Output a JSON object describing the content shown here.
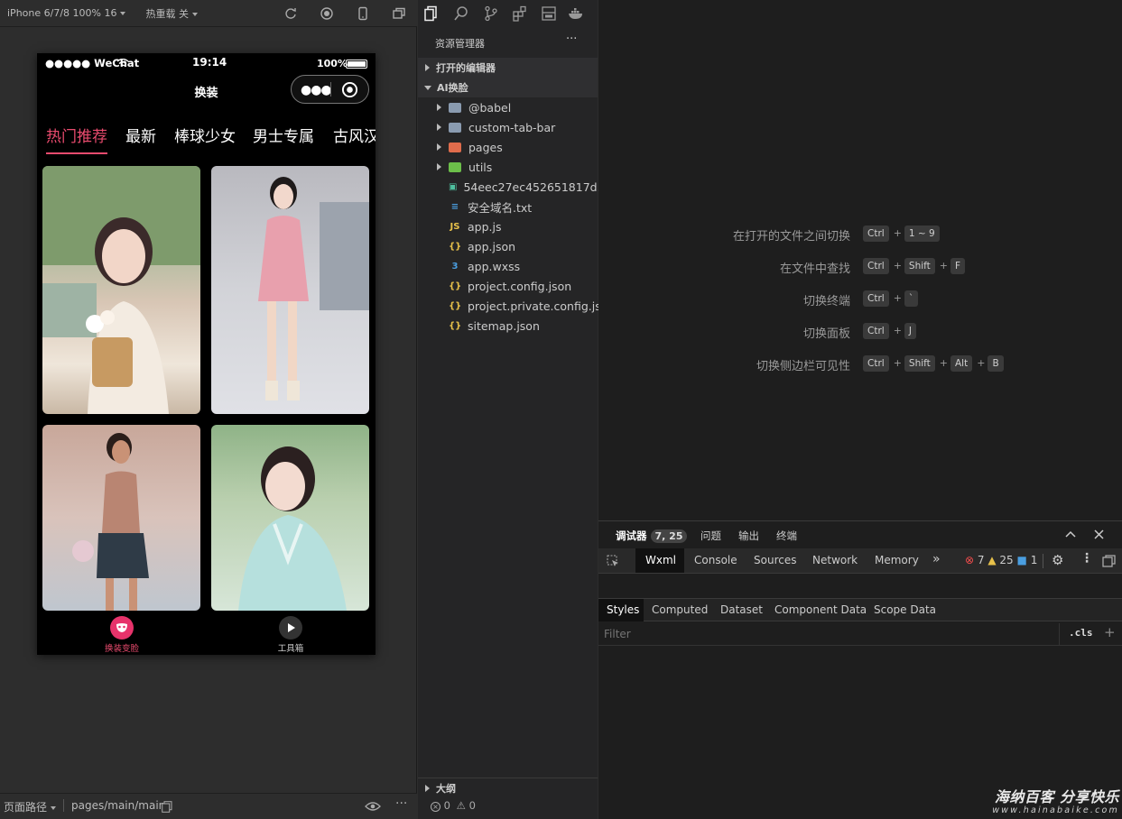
{
  "simulator": {
    "device": "iPhone 6/7/8 100% 16",
    "hot_reload": "热重载 关"
  },
  "phone": {
    "status": {
      "carrier": "●●●●● WeChat",
      "time": "19:14",
      "battery": "100%"
    },
    "nav_title": "换装",
    "tabs": [
      "热门推荐",
      "最新",
      "棒球少女",
      "男士专属",
      "古风汉"
    ],
    "tabbar": [
      {
        "label": "换装变脸",
        "color": "#e94b6e"
      },
      {
        "label": "工具箱",
        "color": "#cccccc"
      }
    ]
  },
  "explorer": {
    "title": "资源管理器",
    "more": "···",
    "section_open": "打开的编辑器",
    "project": "AI换脸",
    "items": [
      {
        "label": "@babel",
        "kind": "folder",
        "icon": "folder-icon",
        "color": "#8a9bb0"
      },
      {
        "label": "custom-tab-bar",
        "kind": "folder",
        "icon": "folder-icon",
        "color": "#8a9bb0"
      },
      {
        "label": "pages",
        "kind": "folder",
        "icon": "pages-folder-icon",
        "color": "#e06c4c"
      },
      {
        "label": "utils",
        "kind": "folder",
        "icon": "utils-folder-icon",
        "color": "#6cbf4a"
      },
      {
        "label": "54eec27ec452651817d...",
        "kind": "file",
        "icon": "image-file-icon",
        "color": "#4fc1a0",
        "glyph": "▣"
      },
      {
        "label": "安全域名.txt",
        "kind": "file",
        "icon": "text-file-icon",
        "color": "#4a9ee0",
        "glyph": "≡"
      },
      {
        "label": "app.js",
        "kind": "file",
        "icon": "js-file-icon",
        "color": "#e8c14a",
        "glyph": "JS"
      },
      {
        "label": "app.json",
        "kind": "file",
        "icon": "json-file-icon",
        "color": "#e8c14a",
        "glyph": "{}"
      },
      {
        "label": "app.wxss",
        "kind": "file",
        "icon": "css-file-icon",
        "color": "#4a9ee0",
        "glyph": "3"
      },
      {
        "label": "project.config.json",
        "kind": "file",
        "icon": "json-file-icon",
        "color": "#e8c14a",
        "glyph": "{}"
      },
      {
        "label": "project.private.config.js...",
        "kind": "file",
        "icon": "json-file-icon",
        "color": "#e8c14a",
        "glyph": "{}"
      },
      {
        "label": "sitemap.json",
        "kind": "file",
        "icon": "json-file-icon",
        "color": "#e8c14a",
        "glyph": "{}"
      }
    ],
    "outline": "大纲",
    "status_errors": "0",
    "status_warnings": "0"
  },
  "welcome": {
    "shortcuts": [
      {
        "label": "在打开的文件之间切换",
        "keys": [
          "Ctrl",
          "1 ~ 9"
        ]
      },
      {
        "label": "在文件中查找",
        "keys": [
          "Ctrl",
          "Shift",
          "F"
        ]
      },
      {
        "label": "切换终端",
        "keys": [
          "Ctrl",
          "`"
        ]
      },
      {
        "label": "切换面板",
        "keys": [
          "Ctrl",
          "J"
        ]
      },
      {
        "label": "切换侧边栏可见性",
        "keys": [
          "Ctrl",
          "Shift",
          "Alt",
          "B"
        ]
      }
    ]
  },
  "debugger": {
    "tabs": [
      "调试器",
      "问题",
      "输出",
      "终端"
    ],
    "badge": "7, 25",
    "devtools_tabs": [
      "Wxml",
      "Console",
      "Sources",
      "Network",
      "Memory"
    ],
    "errors": "7",
    "warnings": "25",
    "infos": "1",
    "style_tabs": [
      "Styles",
      "Computed",
      "Dataset",
      "Component Data",
      "Scope Data"
    ],
    "filter_placeholder": "Filter",
    "cls": ".cls"
  },
  "bottom": {
    "path_label": "页面路径",
    "path": "pages/main/main"
  },
  "watermark": {
    "line1": "海纳百客 分享快乐",
    "line2": "www.hainabaike.com"
  }
}
